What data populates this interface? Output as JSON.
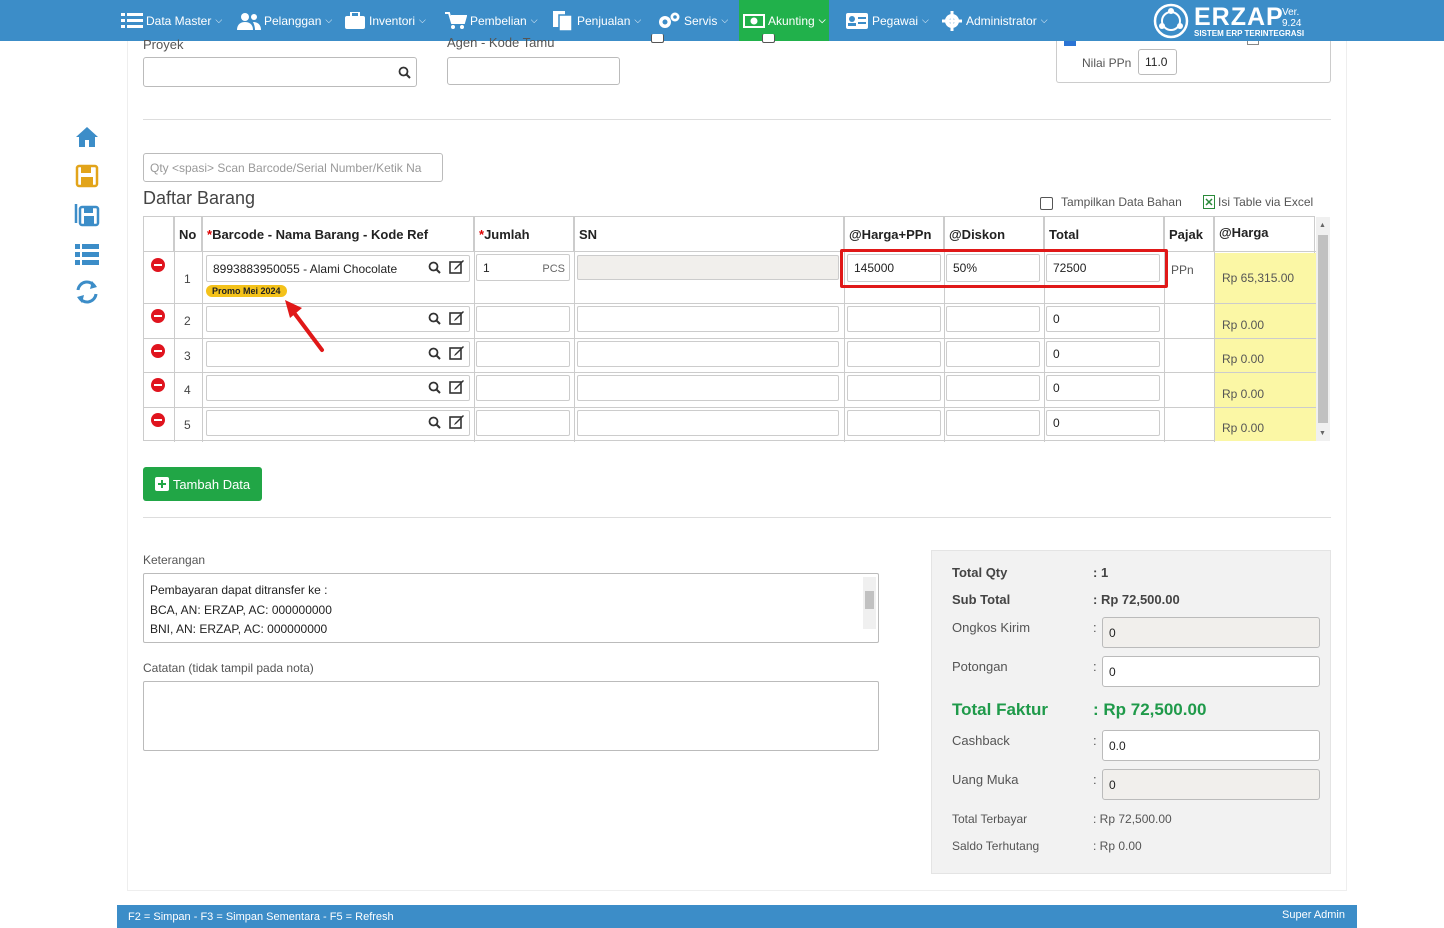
{
  "nav": {
    "items": [
      {
        "label": "Data Master"
      },
      {
        "label": "Pelanggan"
      },
      {
        "label": "Inventori"
      },
      {
        "label": "Pembelian"
      },
      {
        "label": "Penjualan"
      },
      {
        "label": "Servis"
      },
      {
        "label": "Akunting"
      },
      {
        "label": "Pegawai"
      },
      {
        "label": "Administrator"
      }
    ],
    "logo_name": "ERZAP",
    "logo_sub": "SISTEM ERP TERINTEGRASI",
    "version": "Ver. 9.24"
  },
  "form": {
    "proyek_label": "Proyek",
    "agen_label": "Agen - Kode Tamu",
    "ppn_label": "Nilai PPn",
    "ppn_value": "11.0",
    "scan_placeholder": "Qty <spasi> Scan Barcode/Serial Number/Ketik Na"
  },
  "list": {
    "title": "Daftar Barang",
    "show_material_label": "Tampilkan Data Bahan",
    "excel_label": "Isi Table via Excel",
    "headers": {
      "no": "No",
      "barcode": "Barcode - Nama Barang - Kode Ref",
      "jumlah": "Jumlah",
      "sn": "SN",
      "harga": "@Harga+PPn",
      "diskon": "@Diskon",
      "total": "Total",
      "pajak": "Pajak",
      "harga2": "@Harga"
    },
    "rows": [
      {
        "no": "1",
        "barcode": "8993883950055 - Alami Chocolate",
        "promo": "Promo Mei 2024",
        "qty": "1",
        "unit": "PCS",
        "harga": "145000",
        "diskon": "50%",
        "total": "72500",
        "pajak": "PPn",
        "harga2": "Rp 65,315.00"
      },
      {
        "no": "2",
        "total": "0",
        "harga2": "Rp 0.00"
      },
      {
        "no": "3",
        "total": "0",
        "harga2": "Rp 0.00"
      },
      {
        "no": "4",
        "total": "0",
        "harga2": "Rp 0.00"
      },
      {
        "no": "5",
        "total": "0",
        "harga2": "Rp 0.00"
      }
    ],
    "add_button": "Tambah Data"
  },
  "notes": {
    "keterangan_label": "Keterangan",
    "keterangan_lines": [
      "Pembayaran dapat ditransfer ke :",
      "BCA, AN: ERZAP, AC: 000000000",
      "BNI, AN: ERZAP, AC: 000000000"
    ],
    "catatan_label": "Catatan (tidak tampil pada nota)"
  },
  "summary": {
    "total_qty_label": "Total Qty",
    "total_qty": ": 1",
    "sub_total_label": "Sub Total",
    "sub_total": ": Rp 72,500.00",
    "ongkos_label": "Ongkos Kirim",
    "ongkos": "0",
    "potongan_label": "Potongan",
    "potongan": "0",
    "total_faktur_label": "Total Faktur",
    "total_faktur": ": Rp 72,500.00",
    "cashback_label": "Cashback",
    "cashback": "0.0",
    "uang_muka_label": "Uang Muka",
    "uang_muka": "0",
    "terbayar_label": "Total Terbayar",
    "terbayar": ": Rp 72,500.00",
    "saldo_label": "Saldo Terhutang",
    "saldo": ": Rp 0.00",
    "colon": ":"
  },
  "footer": {
    "shortcuts": "F2 = Simpan - F3 = Simpan Sementara - F5 = Refresh",
    "user": "Super Admin"
  },
  "colors": {
    "nav": "#3c8dc8",
    "active": "#21b14b",
    "highlight": "#e01818",
    "promo": "#f4c21a",
    "total_faktur": "#1f9a4a"
  }
}
